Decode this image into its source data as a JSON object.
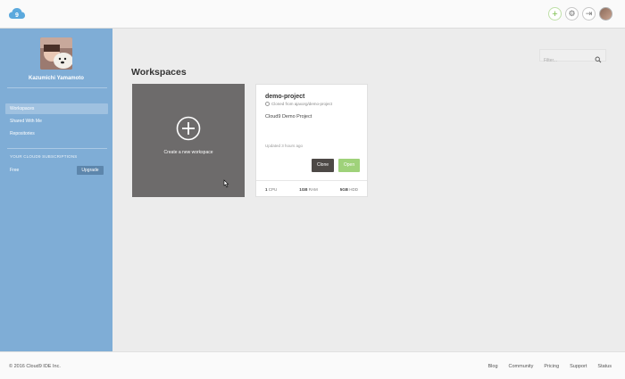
{
  "header": {
    "logo_text": "9",
    "icons": [
      "add-icon",
      "gear-icon",
      "signout-icon",
      "user-avatar"
    ]
  },
  "sidebar": {
    "username": "Kazumichi Yamamoto",
    "nav": [
      {
        "label": "Workspaces",
        "active": true
      },
      {
        "label": "Shared With Me",
        "active": false
      },
      {
        "label": "Repositories",
        "active": false
      }
    ],
    "subscription_heading": "YOUR CLOUD9 SUBSCRIPTIONS",
    "plan": "Free",
    "upgrade_label": "Upgrade"
  },
  "main": {
    "filter_placeholder": "Filter...",
    "title": "Workspaces",
    "create_label": "Create a new workspace",
    "workspace": {
      "name": "demo-project",
      "cloned_from": "Cloned from ajaxorg/demo-project",
      "description": "Cloud9 Demo Project",
      "updated": "Updated 3 hours ago",
      "clone_label": "Clone",
      "open_label": "Open",
      "specs": [
        {
          "value": "1",
          "unit": "CPU"
        },
        {
          "value": "1GB",
          "unit": "RAM"
        },
        {
          "value": "5GB",
          "unit": "HDD"
        }
      ]
    }
  },
  "footer": {
    "copyright": "© 2016  Cloud9 IDE Inc.",
    "links": [
      "Blog",
      "Community",
      "Pricing",
      "Support",
      "Status"
    ]
  },
  "colors": {
    "sidebar": "#7fadd6",
    "create_tile": "#6d6b6b",
    "open_button": "#9fd27a",
    "clone_button": "#4d4946"
  }
}
